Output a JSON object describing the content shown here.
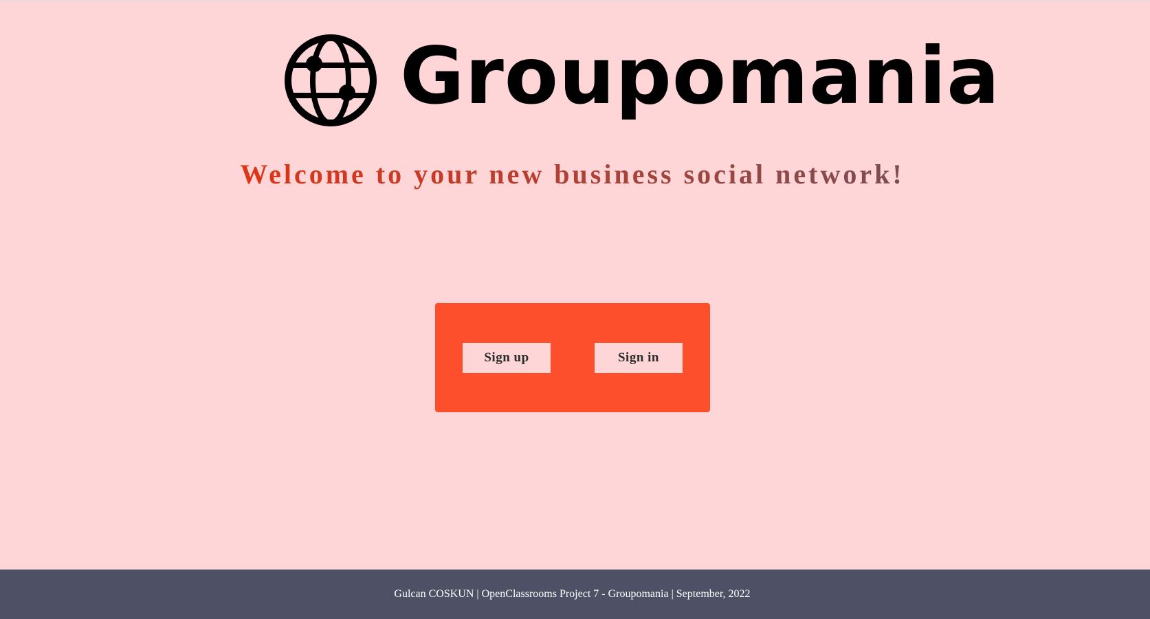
{
  "brand": {
    "name": "Groupomania",
    "logo_icon": "globe-icon"
  },
  "tagline": "Welcome to your new business social network!",
  "auth": {
    "signup_label": "Sign up",
    "signin_label": "Sign in"
  },
  "footer": {
    "text": "Gulcan COSKUN | OpenClassrooms Project 7 - Groupomania | September, 2022"
  },
  "colors": {
    "background": "#FFD6D7",
    "primary": "#FD2D01",
    "panel": "#FD4F2C",
    "tertiary": "#4E5166"
  }
}
